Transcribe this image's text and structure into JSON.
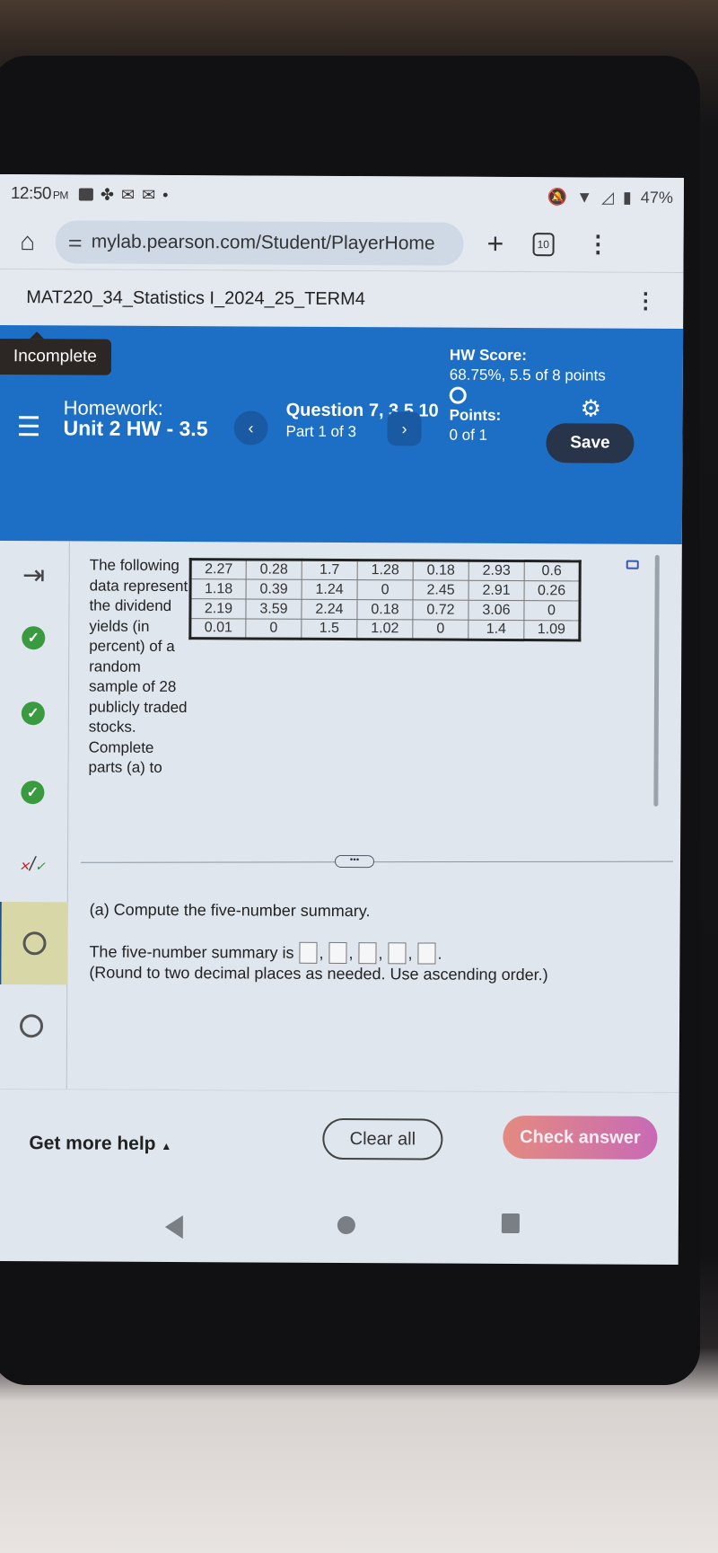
{
  "status_bar": {
    "time": "12:50",
    "ampm": "PM",
    "battery": "47%",
    "left_icons": [
      "youtube-icon",
      "pinwheel-icon",
      "mail-icon",
      "mail-icon",
      "dot-icon"
    ],
    "right_icons": [
      "mute-icon",
      "wifi-icon",
      "signal-icon",
      "battery-icon"
    ]
  },
  "browser": {
    "url": "mylab.pearson.com/Student/PlayerHome",
    "tab_count": "10"
  },
  "course": {
    "title": "MAT220_34_Statistics I_2024_25_TERM4"
  },
  "header": {
    "tooltip": "Incomplete",
    "homework_label": "Homework:",
    "homework_name": "Unit 2 HW - 3.5",
    "question_label": "Question 7, 3.5.10",
    "part": "Part 1 of 3",
    "hw_score_label": "HW Score:",
    "hw_score_value": "68.75%, 5.5 of 8 points",
    "points_label": "Points:",
    "points_value": "0 of 1",
    "save_label": "Save"
  },
  "sidebar": {
    "items": [
      {
        "icon": "collapse-arrow-icon",
        "status": "toggle"
      },
      {
        "icon": "check-circle-icon",
        "status": "correct"
      },
      {
        "icon": "check-circle-icon",
        "status": "correct"
      },
      {
        "icon": "check-circle-icon",
        "status": "correct"
      },
      {
        "icon": "partial-credit-icon",
        "status": "partial"
      },
      {
        "icon": "open-circle-icon",
        "status": "current"
      },
      {
        "icon": "open-circle-icon",
        "status": "unanswered"
      }
    ]
  },
  "question": {
    "intro": "The following data represent the dividend yields (in percent) of a random sample of 28 publicly traded stocks. Complete parts (a) to",
    "table": [
      [
        "2.27",
        "0.28",
        "1.7",
        "1.28",
        "0.18",
        "2.93",
        "0.6"
      ],
      [
        "1.18",
        "0.39",
        "1.24",
        "0",
        "2.45",
        "2.91",
        "0.26"
      ],
      [
        "2.19",
        "3.59",
        "2.24",
        "0.18",
        "0.72",
        "3.06",
        "0"
      ],
      [
        "0.01",
        "0",
        "1.5",
        "1.02",
        "0",
        "1.4",
        "1.09"
      ]
    ],
    "expand_label": "•••",
    "part_a": "(a) Compute the five-number summary.",
    "answer_prefix": "The five-number summary is",
    "answer_values": [
      "",
      "",
      "",
      "",
      ""
    ],
    "round_note": "(Round to two decimal places as needed. Use ascending order.)"
  },
  "footer": {
    "help_label": "Get more help",
    "clear_label": "Clear all",
    "check_label": "Check answer"
  },
  "colors": {
    "header_blue": "#1c6fc4",
    "save_button": "#28344a",
    "check_gradient_start": "#e48a80",
    "check_gradient_end": "#c86ab6",
    "correct_green": "#3a9a40"
  }
}
